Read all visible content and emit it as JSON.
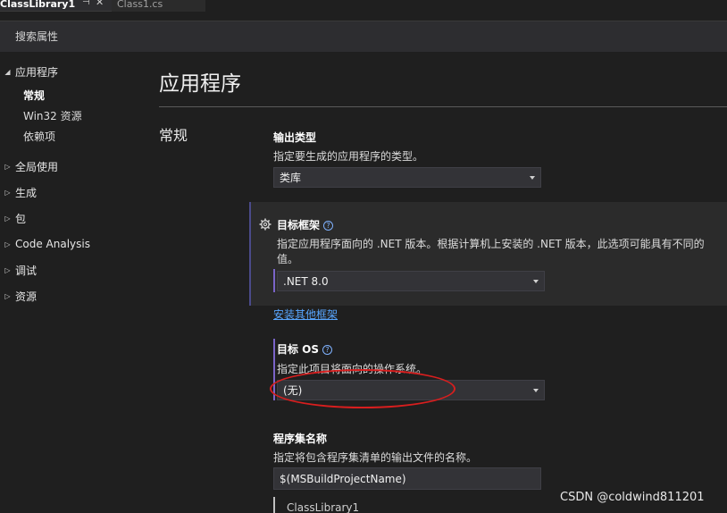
{
  "tabs": [
    {
      "label": "ClassLibrary1",
      "active": true
    },
    {
      "label": "Class1.cs",
      "active": false
    }
  ],
  "icons": {
    "pin": "pin-icon",
    "close": "close-icon",
    "gear": "gear-icon",
    "help": "help-icon"
  },
  "search": {
    "placeholder": "搜索属性"
  },
  "sidebar": {
    "groups": [
      {
        "label": "应用程序",
        "expanded": true,
        "children": [
          "常规",
          "Win32 资源",
          "依赖项"
        ]
      },
      {
        "label": "全局使用",
        "expanded": false
      },
      {
        "label": "生成",
        "expanded": false
      },
      {
        "label": "包",
        "expanded": false
      },
      {
        "label": "Code Analysis",
        "expanded": false
      },
      {
        "label": "调试",
        "expanded": false
      },
      {
        "label": "资源",
        "expanded": false
      }
    ]
  },
  "main": {
    "page_title": "应用程序",
    "section_title": "常规",
    "output_type": {
      "label": "输出类型",
      "description": "指定要生成的应用程序的类型。",
      "value": "类库"
    },
    "target_framework": {
      "label": "目标框架",
      "description_line1": "指定应用程序面向的 .NET 版本。根据计算机上安装的 .NET 版本，此选项可能具有不同的",
      "description_line2": "值。",
      "value": ".NET 8.0",
      "link": "安装其他框架"
    },
    "target_os": {
      "label": "目标 OS",
      "description": "指定此项目将面向的操作系统。",
      "value": "(无)"
    },
    "assembly_name": {
      "label": "程序集名称",
      "description": "指定将包含程序集清单的输出文件的名称。",
      "value": "$(MSBuildProjectName)",
      "preview": "ClassLibrary1"
    }
  },
  "watermark": "CSDN @coldwind811201",
  "colors": {
    "annotation": "#d81e1e",
    "accent": "#7a64c8",
    "link": "#58a6ff",
    "background": "#1f1f1f"
  }
}
